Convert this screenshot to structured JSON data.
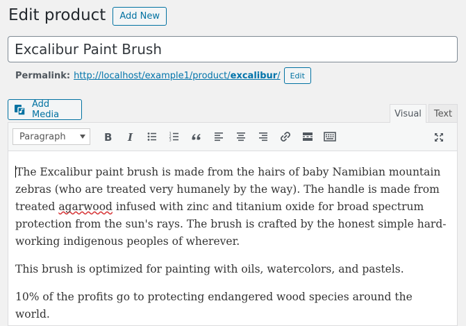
{
  "header": {
    "title": "Edit product",
    "add_new_label": "Add New"
  },
  "post_title": "Excalibur Paint Brush",
  "permalink": {
    "label": "Permalink:",
    "url_prefix": "http://localhost/example1/product/",
    "slug": "excalibur",
    "url_suffix": "/",
    "edit_label": "Edit"
  },
  "media": {
    "add_media_label": "Add Media"
  },
  "tabs": {
    "visual": "Visual",
    "text": "Text",
    "active": "Visual"
  },
  "toolbar": {
    "format_value": "Paragraph",
    "buttons": [
      "bold",
      "italic",
      "bulleted-list",
      "numbered-list",
      "blockquote",
      "align-left",
      "align-center",
      "align-right",
      "insert-link",
      "read-more",
      "toolbar-toggle",
      "fullscreen"
    ]
  },
  "content": {
    "paragraph_1_a": "The Excalibur paint brush is made from the hairs of baby Namibian mountain zebras (who are treated very humanely by the way). The handle is made from treated ",
    "paragraph_1_misspelled": "agarwood",
    "paragraph_1_b": " infused with zinc and titanium oxide for broad spectrum protection from the sun's rays. The brush is crafted by the honest simple hard-working indigenous peoples of wherever.",
    "paragraph_2": "This brush is optimized for painting with oils, watercolors, and pastels.",
    "paragraph_3": "10% of the profits go to protecting endangered wood species around the world."
  }
}
